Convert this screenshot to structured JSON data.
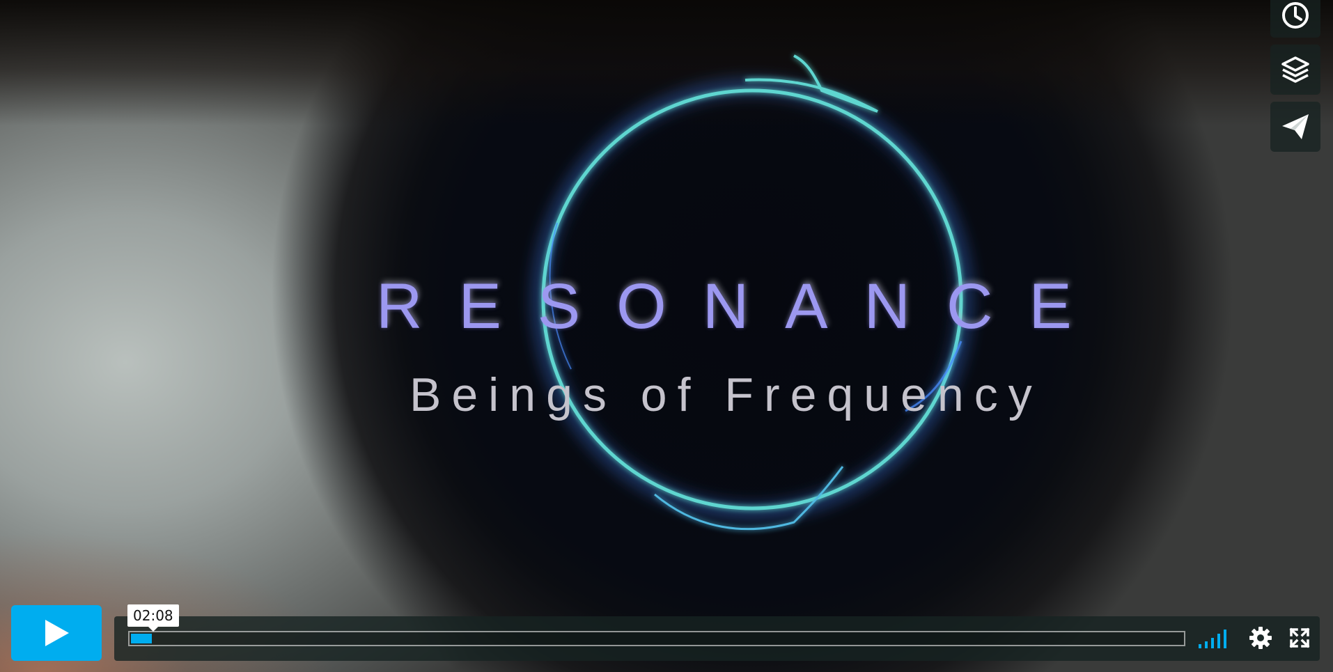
{
  "video": {
    "title_main": "RESONANCE",
    "title_sub": "Beings of Frequency"
  },
  "side_tools": [
    {
      "icon": "clock-icon",
      "label": "Watch Later"
    },
    {
      "icon": "layers-icon",
      "label": "Collections"
    },
    {
      "icon": "paper-plane-icon",
      "label": "Share"
    }
  ],
  "controls": {
    "play_icon": "play-icon",
    "time_tooltip": "02:08",
    "progress_fraction": 0.02,
    "icons": [
      "volume-bars-icon",
      "settings-gear-icon",
      "fullscreen-icon"
    ]
  },
  "colors": {
    "accent": "#00adef",
    "ring": "#5fd6d0",
    "title": "#9c98f0"
  }
}
